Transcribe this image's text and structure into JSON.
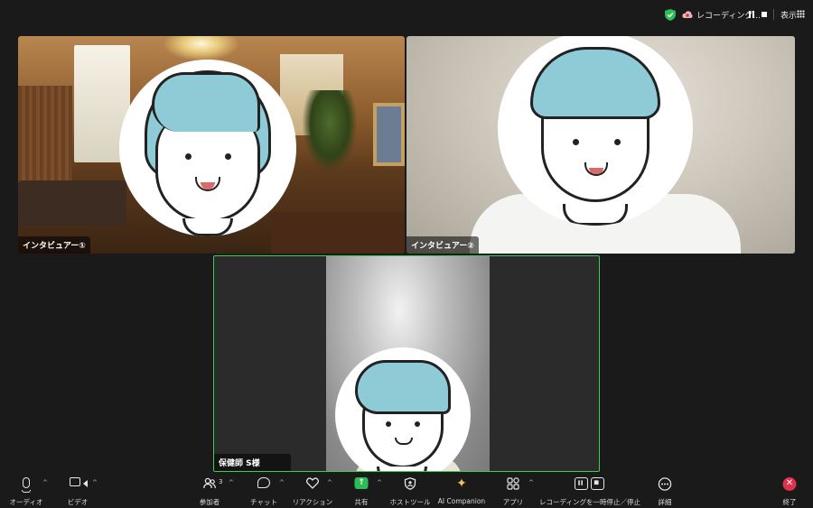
{
  "status": {
    "recording_label": "レコーディング...",
    "view_label": "表示",
    "accent_green": "#2dbd57"
  },
  "participants": [
    {
      "name": "インタビュアー①"
    },
    {
      "name": "インタビュアー②"
    },
    {
      "name": "保健師 S様",
      "active_speaker": true
    }
  ],
  "toolbar": {
    "audio": "オーディオ",
    "video": "ビデオ",
    "participants": "参加者",
    "participant_count": "3",
    "chat": "チャット",
    "reactions": "リアクション",
    "share": "共有",
    "host_tools": "ホストツール",
    "ai_companion": "AI Companion",
    "apps": "アプリ",
    "recording": "レコーディングを一時停止／停止",
    "more": "詳細",
    "end": "終了",
    "chevron": "^"
  }
}
